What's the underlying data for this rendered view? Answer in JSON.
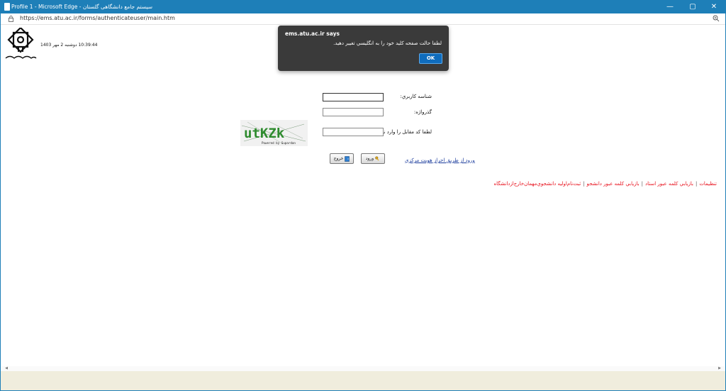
{
  "window": {
    "title": "Profile 1 - Microsoft Edge - سیستم جامع دانشگاهی گلستان",
    "minimize": "—",
    "maximize": "▢",
    "close": "✕"
  },
  "address": {
    "url": "https://ems.atu.ac.ir/forms/authenticateuser/main.htm"
  },
  "header": {
    "datetime": "10:39:44 دوشنبه 2 مهر 1403"
  },
  "form": {
    "username_label": "شناسه کاربري:",
    "username_value": "",
    "password_label": "گذرواژه:",
    "password_value": "",
    "captcha_label": "لطفا کد مقابل را وارد نمایید:",
    "captcha_value": "",
    "captcha_text": "utKZk",
    "captcha_footer": "Powered by Supardan",
    "login_button": "ورود",
    "exit_button": "خروج",
    "sso_link": "ورود از طريق احراز هويت مرکزي"
  },
  "links": [
    "تنظیمات",
    "بازيابي كلمه عبور استاد",
    "بازيابي كلمه عبور دانشجو",
    "ثبت‌نام‌اوليه دانشجوي‌مهمان‌خارج‌ازدانشگاه"
  ],
  "dialog": {
    "title": "ems.atu.ac.ir says",
    "message": "لطفا حالت صفحه کليد خود را به انگليسي تغيير دهيد.",
    "ok": "OK"
  },
  "colors": {
    "titlebar": "#1e7fb8",
    "link_red": "#e8101c",
    "link_blue": "#1a3b9c",
    "dialog_bg": "#3a3a3a",
    "ok_button": "#0f6cbd"
  }
}
